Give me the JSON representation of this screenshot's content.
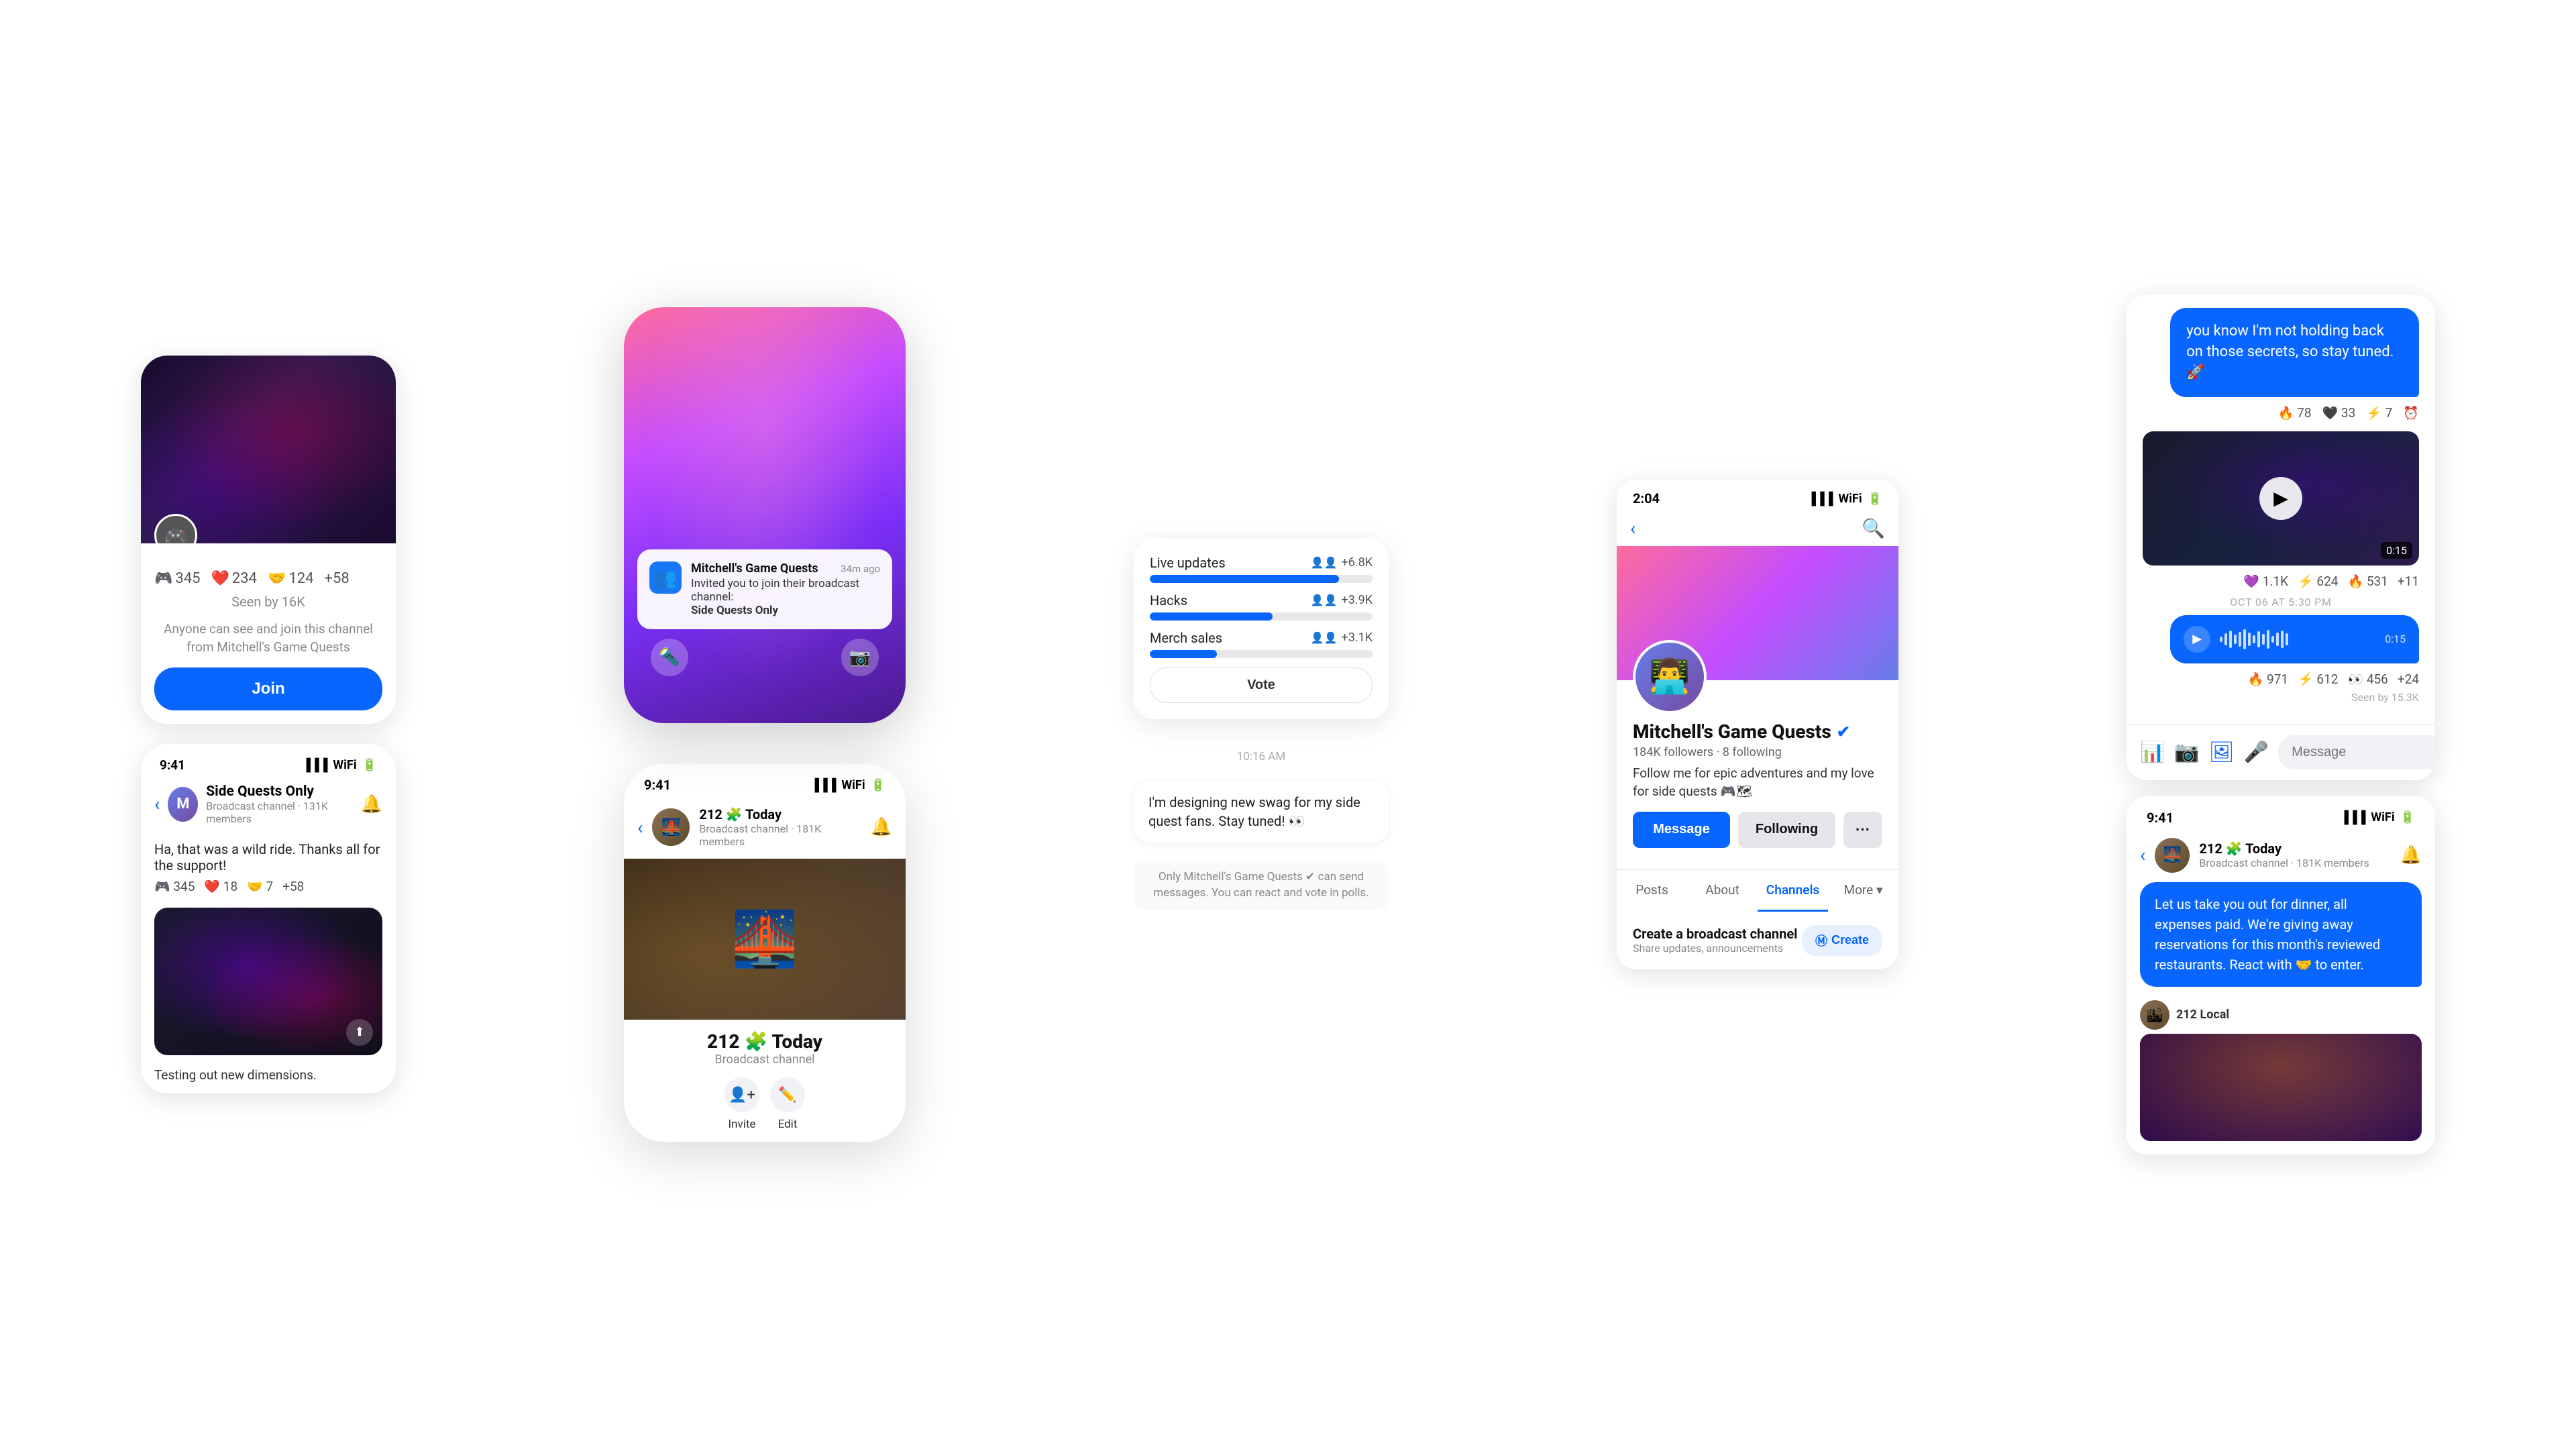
{
  "panel1": {
    "hero_emoji": "🎮",
    "avatar_emoji": "🎮",
    "reactions": [
      {
        "icon": "🎮",
        "count": "345"
      },
      {
        "icon": "❤️",
        "count": "234"
      },
      {
        "icon": "🤝",
        "count": "124"
      },
      {
        "icon": "more",
        "label": "+58"
      }
    ],
    "seen_text": "Seen by 16K",
    "notice_text": "Anyone can see and join this channel from Mitchell's Game Quests",
    "join_label": "Join"
  },
  "side_quests": {
    "time": "9:41",
    "channel_name": "Side Quests Only",
    "channel_meta": "Broadcast channel · 131K members",
    "message": "Ha, that was a wild ride. Thanks all for the support!",
    "reactions": [
      {
        "icon": "🎮",
        "count": "345"
      },
      {
        "icon": "❤️",
        "count": "18"
      },
      {
        "icon": "🤝",
        "count": "7"
      },
      {
        "icon": "more",
        "label": "+58"
      }
    ],
    "image_caption": "Testing out new dimensions."
  },
  "panel2": {
    "notification": {
      "sender": "Mitchell's Game Quests",
      "time": "34m ago",
      "body1": "Invited you to join their broadcast channel:",
      "body2": "Side Quests Only"
    }
  },
  "panel2b": {
    "time": "9:41",
    "channel_name": "212 🧩 Today",
    "channel_meta": "Broadcast channel · 181K members",
    "big_title": "212 🧩 Today",
    "big_subtitle": "Broadcast channel",
    "actions": [
      {
        "icon": "👤+",
        "label": "Invite"
      },
      {
        "icon": "✏️",
        "label": "Edit"
      }
    ]
  },
  "panel3": {
    "poll": {
      "options": [
        {
          "label": "Live updates",
          "count": "+6.8K",
          "fill": 85
        },
        {
          "label": "Hacks",
          "count": "+3.9K",
          "fill": 55
        },
        {
          "label": "Merch sales",
          "count": "+3.1K",
          "fill": 30
        }
      ],
      "vote_label": "Vote"
    },
    "time": "10:16 AM",
    "message": "I'm designing new swag for my side quest fans. Stay tuned! 👀",
    "notice": "Only Mitchell's Game Quests ✔ can send messages. You can react and vote in polls."
  },
  "panel4": {
    "time": "2:04",
    "profile_name": "Mitchell's Game Quests",
    "verified": true,
    "followers": "184K followers · 8 following",
    "bio": "Follow me for epic adventures and my love for side quests 🎮🗺",
    "buttons": {
      "message": "Message",
      "following": "Following",
      "more": "···"
    },
    "tabs": [
      "Posts",
      "About",
      "Channels",
      "More"
    ],
    "active_tab": "Channels",
    "create_broadcast": {
      "title": "Create a broadcast channel",
      "subtitle": "Share updates, announcements",
      "button": "Create"
    }
  },
  "panel5": {
    "messages": [
      {
        "text": "you know I'm not holding back on those secrets, so stay tuned. 🚀",
        "type": "out"
      },
      {
        "reactions": [
          {
            "icon": "🔥",
            "count": "78"
          },
          {
            "icon": "🖤",
            "count": "33"
          },
          {
            "icon": "⚡",
            "count": "7"
          },
          {
            "icon": "⏰",
            "count": ""
          }
        ]
      },
      {
        "type": "video",
        "duration": "0:15"
      },
      {
        "reactions2": [
          {
            "icon": "💜",
            "count": "1.1K"
          },
          {
            "icon": "⚡",
            "count": "624"
          },
          {
            "icon": "🔥",
            "count": "531"
          },
          {
            "icon": "+11",
            "count": ""
          }
        ]
      },
      {
        "date": "OCT 06 AT 5:30 PM"
      },
      {
        "type": "audio",
        "duration": "0:15"
      },
      {
        "reactions3": [
          {
            "icon": "🔥",
            "count": "971"
          },
          {
            "icon": "⚡",
            "count": "612"
          },
          {
            "icon": "👁",
            "count": "456"
          },
          {
            "icon": "+24",
            "count": ""
          }
        ]
      },
      {
        "seen": "Seen by 15.3K"
      }
    ],
    "input_placeholder": "Message"
  },
  "panel5b": {
    "time": "9:41",
    "channel_name": "212 🧩 Today",
    "channel_meta": "Broadcast channel · 181K members",
    "message": "Let us take you out for dinner, all expenses paid. We're giving away reservations for this month's reviewed restaurants. React with 🤝 to enter.",
    "sender_name": "212 Local",
    "image_alt": "restaurant image"
  }
}
